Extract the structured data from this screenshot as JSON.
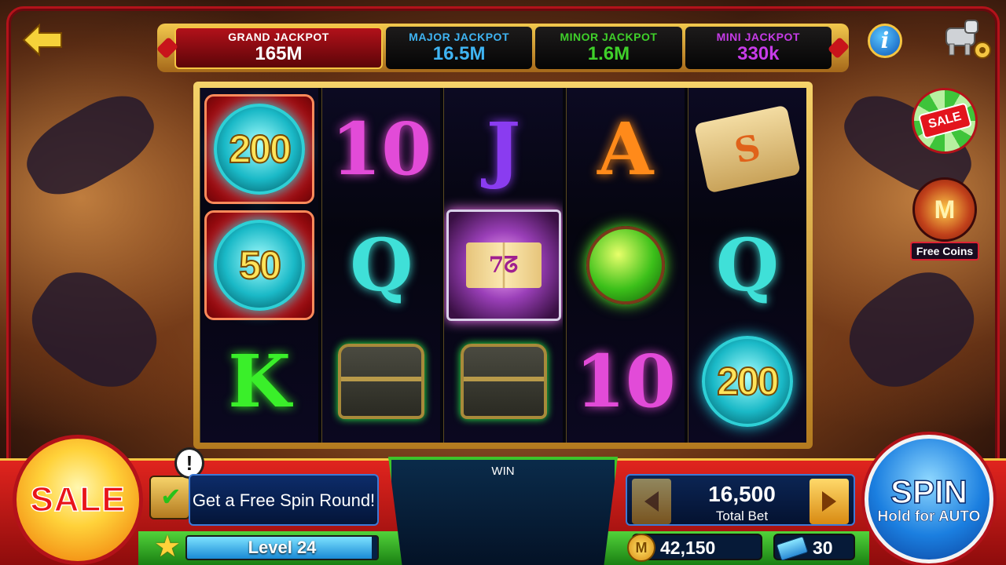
{
  "jackpots": [
    {
      "label": "GRAND JACKPOT",
      "value": "165M",
      "color": "#ffffff"
    },
    {
      "label": "MAJOR JACKPOT",
      "value": "16.5M",
      "color": "#3fb4f2"
    },
    {
      "label": "MINOR JACKPOT",
      "value": "1.6M",
      "color": "#3fd02a"
    },
    {
      "label": "MINI JACKPOT",
      "value": "330k",
      "color": "#c73ce8"
    }
  ],
  "icons": {
    "back": "back-arrow-icon",
    "info": "info-icon",
    "info_glyph": "i",
    "settings": "robot-dog-settings-icon"
  },
  "reels": [
    [
      {
        "type": "coin-orb",
        "value": "200"
      },
      {
        "type": "coin-orb",
        "value": "50"
      },
      {
        "type": "letter",
        "value": "K",
        "color": "#3aef2a"
      }
    ],
    [
      {
        "type": "letter",
        "value": "10",
        "color": "#e24bd8"
      },
      {
        "type": "letter",
        "value": "Q",
        "color": "#3fe0d8"
      },
      {
        "type": "chest"
      }
    ],
    [
      {
        "type": "letter",
        "value": "J",
        "color": "#8a3cf0"
      },
      {
        "type": "spellbook",
        "value": "7ᘔ"
      },
      {
        "type": "chest"
      }
    ],
    [
      {
        "type": "letter",
        "value": "A",
        "color": "#ff8a1a"
      },
      {
        "type": "potion"
      },
      {
        "type": "letter",
        "value": "10",
        "color": "#e24bd8"
      }
    ],
    [
      {
        "type": "scroll",
        "value": "S"
      },
      {
        "type": "letter",
        "value": "Q",
        "color": "#3fe0d8"
      },
      {
        "type": "orb",
        "value": "200"
      }
    ]
  ],
  "side": {
    "sale_label": "SALE",
    "free_coins_label": "Free Coins",
    "free_coins_glyph": "M"
  },
  "bottom": {
    "sale_label": "SALE",
    "quest_alert": "!",
    "quest_text": "Get a Free Spin Round!",
    "level_text": "Level 24",
    "level_progress": 0.97,
    "win_label": "WIN",
    "total_bet_value": "16,500",
    "total_bet_label": "Total Bet",
    "coins_glyph": "M",
    "coins": "42,150",
    "tickets": "30",
    "spin_label": "SPIN",
    "spin_sub": "Hold for AUTO"
  }
}
